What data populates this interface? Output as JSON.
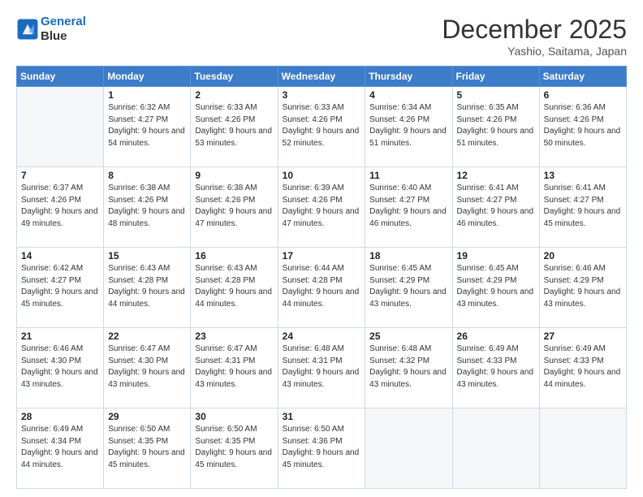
{
  "header": {
    "logo_line1": "General",
    "logo_line2": "Blue",
    "month": "December 2025",
    "location": "Yashio, Saitama, Japan"
  },
  "weekdays": [
    "Sunday",
    "Monday",
    "Tuesday",
    "Wednesday",
    "Thursday",
    "Friday",
    "Saturday"
  ],
  "weeks": [
    [
      {
        "day": "",
        "sunrise": "",
        "sunset": "",
        "daylight": ""
      },
      {
        "day": "1",
        "sunrise": "Sunrise: 6:32 AM",
        "sunset": "Sunset: 4:27 PM",
        "daylight": "Daylight: 9 hours and 54 minutes."
      },
      {
        "day": "2",
        "sunrise": "Sunrise: 6:33 AM",
        "sunset": "Sunset: 4:26 PM",
        "daylight": "Daylight: 9 hours and 53 minutes."
      },
      {
        "day": "3",
        "sunrise": "Sunrise: 6:33 AM",
        "sunset": "Sunset: 4:26 PM",
        "daylight": "Daylight: 9 hours and 52 minutes."
      },
      {
        "day": "4",
        "sunrise": "Sunrise: 6:34 AM",
        "sunset": "Sunset: 4:26 PM",
        "daylight": "Daylight: 9 hours and 51 minutes."
      },
      {
        "day": "5",
        "sunrise": "Sunrise: 6:35 AM",
        "sunset": "Sunset: 4:26 PM",
        "daylight": "Daylight: 9 hours and 51 minutes."
      },
      {
        "day": "6",
        "sunrise": "Sunrise: 6:36 AM",
        "sunset": "Sunset: 4:26 PM",
        "daylight": "Daylight: 9 hours and 50 minutes."
      }
    ],
    [
      {
        "day": "7",
        "sunrise": "Sunrise: 6:37 AM",
        "sunset": "Sunset: 4:26 PM",
        "daylight": "Daylight: 9 hours and 49 minutes."
      },
      {
        "day": "8",
        "sunrise": "Sunrise: 6:38 AM",
        "sunset": "Sunset: 4:26 PM",
        "daylight": "Daylight: 9 hours and 48 minutes."
      },
      {
        "day": "9",
        "sunrise": "Sunrise: 6:38 AM",
        "sunset": "Sunset: 4:26 PM",
        "daylight": "Daylight: 9 hours and 47 minutes."
      },
      {
        "day": "10",
        "sunrise": "Sunrise: 6:39 AM",
        "sunset": "Sunset: 4:26 PM",
        "daylight": "Daylight: 9 hours and 47 minutes."
      },
      {
        "day": "11",
        "sunrise": "Sunrise: 6:40 AM",
        "sunset": "Sunset: 4:27 PM",
        "daylight": "Daylight: 9 hours and 46 minutes."
      },
      {
        "day": "12",
        "sunrise": "Sunrise: 6:41 AM",
        "sunset": "Sunset: 4:27 PM",
        "daylight": "Daylight: 9 hours and 46 minutes."
      },
      {
        "day": "13",
        "sunrise": "Sunrise: 6:41 AM",
        "sunset": "Sunset: 4:27 PM",
        "daylight": "Daylight: 9 hours and 45 minutes."
      }
    ],
    [
      {
        "day": "14",
        "sunrise": "Sunrise: 6:42 AM",
        "sunset": "Sunset: 4:27 PM",
        "daylight": "Daylight: 9 hours and 45 minutes."
      },
      {
        "day": "15",
        "sunrise": "Sunrise: 6:43 AM",
        "sunset": "Sunset: 4:28 PM",
        "daylight": "Daylight: 9 hours and 44 minutes."
      },
      {
        "day": "16",
        "sunrise": "Sunrise: 6:43 AM",
        "sunset": "Sunset: 4:28 PM",
        "daylight": "Daylight: 9 hours and 44 minutes."
      },
      {
        "day": "17",
        "sunrise": "Sunrise: 6:44 AM",
        "sunset": "Sunset: 4:28 PM",
        "daylight": "Daylight: 9 hours and 44 minutes."
      },
      {
        "day": "18",
        "sunrise": "Sunrise: 6:45 AM",
        "sunset": "Sunset: 4:29 PM",
        "daylight": "Daylight: 9 hours and 43 minutes."
      },
      {
        "day": "19",
        "sunrise": "Sunrise: 6:45 AM",
        "sunset": "Sunset: 4:29 PM",
        "daylight": "Daylight: 9 hours and 43 minutes."
      },
      {
        "day": "20",
        "sunrise": "Sunrise: 6:46 AM",
        "sunset": "Sunset: 4:29 PM",
        "daylight": "Daylight: 9 hours and 43 minutes."
      }
    ],
    [
      {
        "day": "21",
        "sunrise": "Sunrise: 6:46 AM",
        "sunset": "Sunset: 4:30 PM",
        "daylight": "Daylight: 9 hours and 43 minutes."
      },
      {
        "day": "22",
        "sunrise": "Sunrise: 6:47 AM",
        "sunset": "Sunset: 4:30 PM",
        "daylight": "Daylight: 9 hours and 43 minutes."
      },
      {
        "day": "23",
        "sunrise": "Sunrise: 6:47 AM",
        "sunset": "Sunset: 4:31 PM",
        "daylight": "Daylight: 9 hours and 43 minutes."
      },
      {
        "day": "24",
        "sunrise": "Sunrise: 6:48 AM",
        "sunset": "Sunset: 4:31 PM",
        "daylight": "Daylight: 9 hours and 43 minutes."
      },
      {
        "day": "25",
        "sunrise": "Sunrise: 6:48 AM",
        "sunset": "Sunset: 4:32 PM",
        "daylight": "Daylight: 9 hours and 43 minutes."
      },
      {
        "day": "26",
        "sunrise": "Sunrise: 6:49 AM",
        "sunset": "Sunset: 4:33 PM",
        "daylight": "Daylight: 9 hours and 43 minutes."
      },
      {
        "day": "27",
        "sunrise": "Sunrise: 6:49 AM",
        "sunset": "Sunset: 4:33 PM",
        "daylight": "Daylight: 9 hours and 44 minutes."
      }
    ],
    [
      {
        "day": "28",
        "sunrise": "Sunrise: 6:49 AM",
        "sunset": "Sunset: 4:34 PM",
        "daylight": "Daylight: 9 hours and 44 minutes."
      },
      {
        "day": "29",
        "sunrise": "Sunrise: 6:50 AM",
        "sunset": "Sunset: 4:35 PM",
        "daylight": "Daylight: 9 hours and 45 minutes."
      },
      {
        "day": "30",
        "sunrise": "Sunrise: 6:50 AM",
        "sunset": "Sunset: 4:35 PM",
        "daylight": "Daylight: 9 hours and 45 minutes."
      },
      {
        "day": "31",
        "sunrise": "Sunrise: 6:50 AM",
        "sunset": "Sunset: 4:36 PM",
        "daylight": "Daylight: 9 hours and 45 minutes."
      },
      {
        "day": "",
        "sunrise": "",
        "sunset": "",
        "daylight": ""
      },
      {
        "day": "",
        "sunrise": "",
        "sunset": "",
        "daylight": ""
      },
      {
        "day": "",
        "sunrise": "",
        "sunset": "",
        "daylight": ""
      }
    ]
  ]
}
